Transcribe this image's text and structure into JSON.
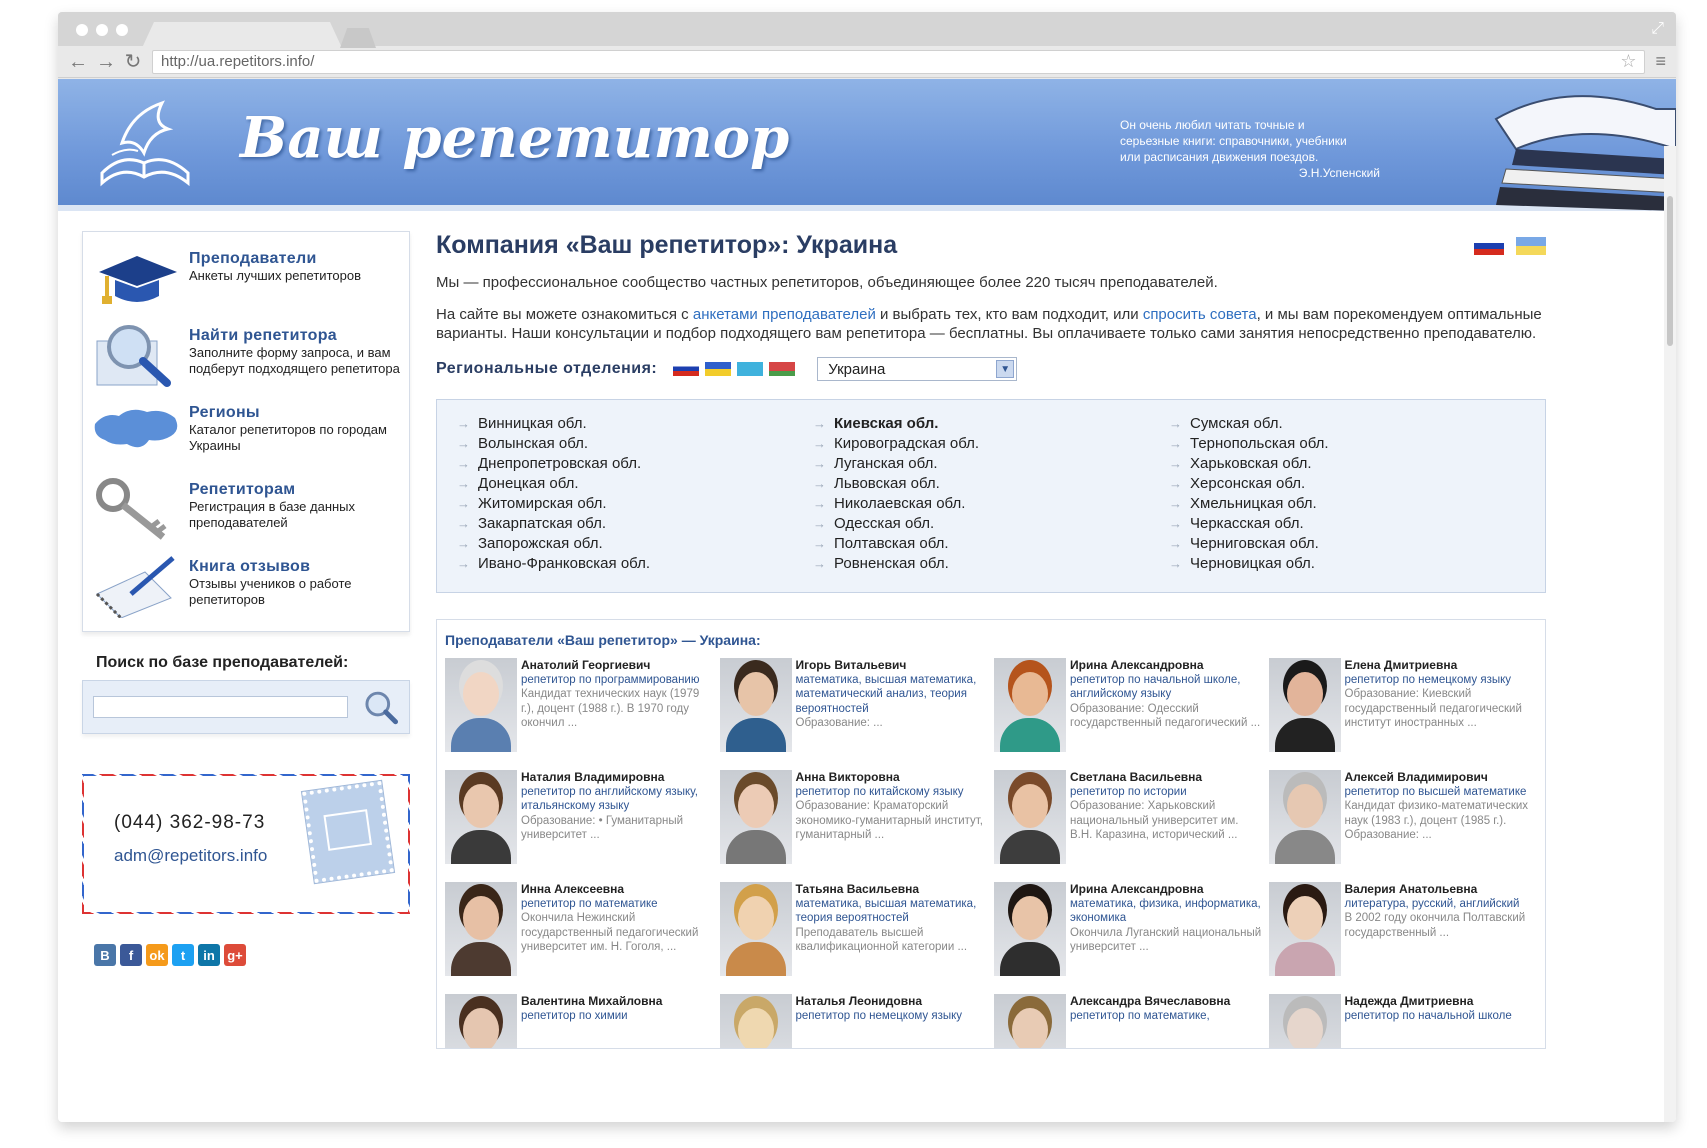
{
  "browser": {
    "url": "http://ua.repetitors.info/"
  },
  "banner": {
    "site_title": "Ваш репетитор",
    "quote_lines": [
      "Он очень любил читать точные и",
      "серьезные книги: справочники, учебники",
      "или расписания движения поездов."
    ],
    "quote_author": "Э.Н.Успенский"
  },
  "sidebar": {
    "items": [
      {
        "title": "Преподаватели",
        "desc": "Анкеты лучших репетиторов",
        "icon": "graduation-cap-icon"
      },
      {
        "title": "Найти репетитора",
        "desc": "Заполните форму запроса, и вам подберут подходящего репетитора",
        "icon": "magnifier-icon"
      },
      {
        "title": "Регионы",
        "desc": "Каталог репетиторов по городам Украины",
        "icon": "ukraine-map-icon"
      },
      {
        "title": "Репетиторам",
        "desc": "Регистрация в базе данных преподавателей",
        "icon": "key-icon"
      },
      {
        "title": "Книга отзывов",
        "desc": "Отзывы учеников о работе репетиторов",
        "icon": "notebook-pen-icon"
      }
    ],
    "search_label": "Поиск по базе преподавателей:",
    "phone": "(044) 362-98-73",
    "email": "adm@repetitors.info"
  },
  "main": {
    "title": "Компания «Ваш репетитор»: Украина",
    "intro": "Мы — профессиональное сообщество частных репетиторов, объединяющее более 220 тысяч преподавателей.",
    "p2_a": "На сайте вы можете ознакомиться с ",
    "p2_link1": "анкетами преподавателей",
    "p2_b": " и выбрать тех, кто вам подходит, или ",
    "p2_link2": "спросить совета",
    "p2_c": ", и мы вам порекомендуем оптимальные варианты. Наши консультации и подбор подходящего вам репетитора — бесплатны. Вы оплачиваете только сами занятия непосредственно преподавателю.",
    "regional_label": "Региональные отделения:",
    "country_selected": "Украина",
    "regions_col1": [
      "Винницкая обл.",
      "Волынская обл.",
      "Днепропетровская обл.",
      "Донецкая обл.",
      "Житомирская обл.",
      "Закарпатская обл.",
      "Запорожская обл.",
      "Ивано-Франковская обл."
    ],
    "regions_col2": [
      "Киевская обл.",
      "Кировоградская обл.",
      "Луганская обл.",
      "Львовская обл.",
      "Николаевская обл.",
      "Одесская обл.",
      "Полтавская обл.",
      "Ровненская обл."
    ],
    "regions_col3": [
      "Сумская обл.",
      "Тернопольская обл.",
      "Харьковская обл.",
      "Херсонская обл.",
      "Хмельницкая обл.",
      "Черкасская обл.",
      "Черниговская обл.",
      "Черновицкая обл."
    ],
    "tutors_title": "Преподаватели «Ваш репетитор» — Украина:",
    "tutors": [
      {
        "name": "Анатолий Георгиевич",
        "subj": "репетитор по программированию",
        "desc": "Кандидат технических наук (1979 г.), доцент (1988 г.). В 1970 году окончил ..."
      },
      {
        "name": "Игорь Витальевич",
        "subj": "математика, высшая математика, математический анализ, теория вероятностей",
        "desc": "Образование: ..."
      },
      {
        "name": "Ирина Александровна",
        "subj": "репетитор по начальной школе, английскому языку",
        "desc": "Образование: Одесский государственный педагогический ..."
      },
      {
        "name": "Елена Дмитриевна",
        "subj": "репетитор по немецкому языку",
        "desc": "Образование: Киевский государственный педагогический институт иностранных ..."
      },
      {
        "name": "Наталия Владимировна",
        "subj": "репетитор по английскому языку, итальянскому языку",
        "desc": "Образование: • Гуманитарный университет ..."
      },
      {
        "name": "Анна Викторовна",
        "subj": "репетитор по китайскому языку",
        "desc": "Образование: Краматорский экономико-гуманитарный институт, гуманитарный ..."
      },
      {
        "name": "Светлана Васильевна",
        "subj": "репетитор по истории",
        "desc": "Образование: Харьковский национальный университет им. В.Н. Каразина, исторический ..."
      },
      {
        "name": "Алексей Владимирович",
        "subj": "репетитор по высшей математике",
        "desc": "Кандидат физико-математических наук (1983 г.), доцент (1985 г.). Образование: ..."
      },
      {
        "name": "Инна Алексеевна",
        "subj": "репетитор по математике",
        "desc": "Окончила Нежинский государственный педагогический университет им. Н. Гоголя, ..."
      },
      {
        "name": "Татьяна Васильевна",
        "subj": "математика, высшая математика, теория вероятностей",
        "desc": "Преподаватель высшей квалификационной категории ..."
      },
      {
        "name": "Ирина Александровна",
        "subj": "математика, физика, информатика, экономика",
        "desc": "Окончила Луганский национальный университет ..."
      },
      {
        "name": "Валерия Анатольевна",
        "subj": "литература, русский, английский",
        "desc": "В 2002 году окончила Полтавский государственный ..."
      },
      {
        "name": "Валентина Михайловна",
        "subj": "репетитор по химии",
        "desc": ""
      },
      {
        "name": "Наталья Леонидовна",
        "subj": "репетитор по немецкому языку",
        "desc": ""
      },
      {
        "name": "Александра Вячеславовна",
        "subj": "репетитор по математике,",
        "desc": ""
      },
      {
        "name": "Надежда Дмитриевна",
        "subj": "репетитор по начальной школе",
        "desc": ""
      }
    ]
  },
  "colors": {
    "accent": "#2f5592",
    "banner": "#7aa0dc",
    "link": "#2f6fc0"
  }
}
